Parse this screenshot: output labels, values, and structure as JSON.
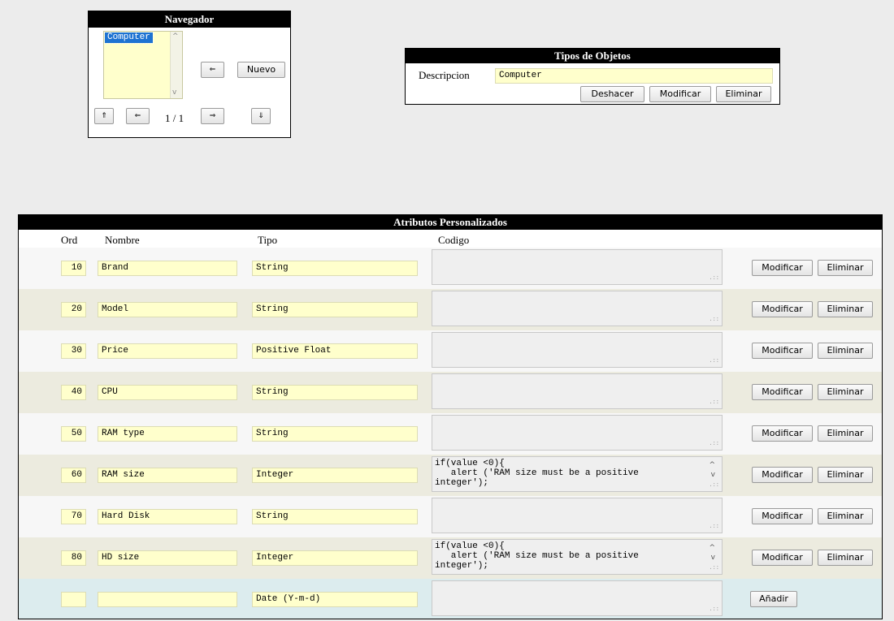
{
  "navigator": {
    "title": "Navegador",
    "list_items": [
      "Computer"
    ],
    "back_label": "⇐",
    "new_label": "Nuevo",
    "first_label": "⇑",
    "prev_label": "⇐",
    "page_indicator": "1 / 1",
    "next_label": "⇒",
    "last_label": "⇓"
  },
  "object_types": {
    "title": "Tipos de Objetos",
    "description_label": "Descripcion",
    "description_value": "Computer",
    "undo_label": "Deshacer",
    "modify_label": "Modificar",
    "delete_label": "Eliminar"
  },
  "custom_attributes": {
    "title": "Atributos Personalizados",
    "headers": {
      "ord": "Ord",
      "nombre": "Nombre",
      "tipo": "Tipo",
      "codigo": "Codigo"
    },
    "row_modify_label": "Modificar",
    "row_delete_label": "Eliminar",
    "add_label": "Añadir",
    "rows": [
      {
        "ord": "10",
        "nombre": "Brand",
        "tipo": "String",
        "codigo": ""
      },
      {
        "ord": "20",
        "nombre": "Model",
        "tipo": "String",
        "codigo": ""
      },
      {
        "ord": "30",
        "nombre": "Price",
        "tipo": "Positive Float",
        "codigo": ""
      },
      {
        "ord": "40",
        "nombre": "CPU",
        "tipo": "String",
        "codigo": ""
      },
      {
        "ord": "50",
        "nombre": "RAM type",
        "tipo": "String",
        "codigo": ""
      },
      {
        "ord": "60",
        "nombre": "RAM size",
        "tipo": "Integer",
        "codigo": "if(value <0){\n   alert ('RAM size must be a positive\ninteger');"
      },
      {
        "ord": "70",
        "nombre": "Hard Disk",
        "tipo": "String",
        "codigo": ""
      },
      {
        "ord": "80",
        "nombre": "HD size",
        "tipo": "Integer",
        "codigo": "if(value <0){\n   alert ('RAM size must be a positive\ninteger');"
      }
    ],
    "new_row": {
      "ord": "",
      "nombre": "",
      "tipo": "Date (Y-m-d)",
      "codigo": ""
    }
  },
  "colors": {
    "row_light": "#f7f7f7",
    "row_dark": "#ecebdf",
    "new_row": "#dcecee",
    "field_bg": "#ffffcc",
    "list_selection": "#1e73d2"
  }
}
